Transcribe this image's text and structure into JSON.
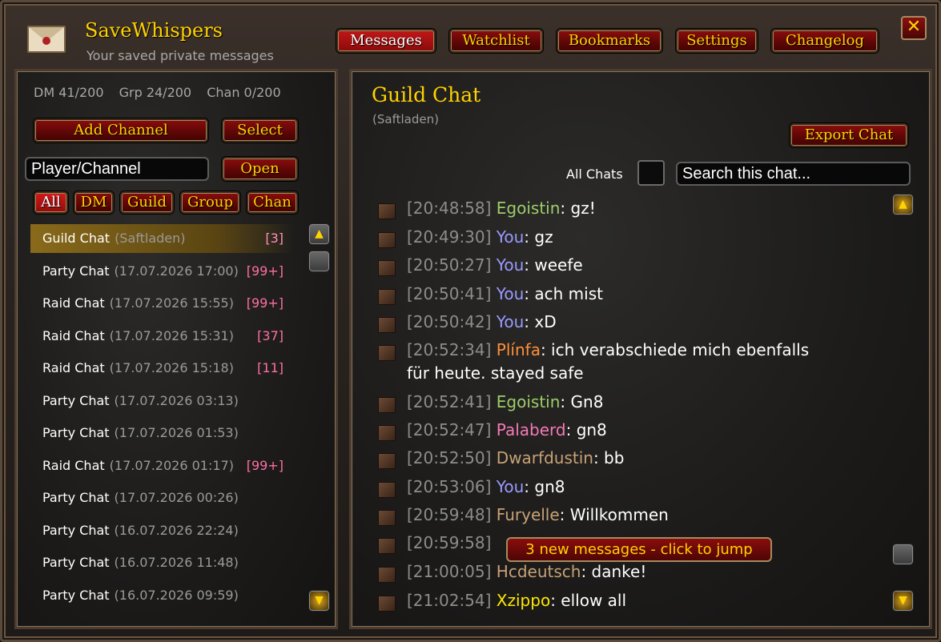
{
  "app": {
    "title": "SaveWhispers",
    "subtitle": "Your saved private messages"
  },
  "tabs": [
    {
      "label": "Messages",
      "active": true
    },
    {
      "label": "Watchlist",
      "active": false
    },
    {
      "label": "Bookmarks",
      "active": false
    },
    {
      "label": "Settings",
      "active": false
    },
    {
      "label": "Changelog",
      "active": false
    }
  ],
  "close_icon": "x-icon",
  "left": {
    "counts": [
      "DM 41/200",
      "Grp 24/200",
      "Chan 0/200"
    ],
    "add_channel": "Add Channel",
    "select": "Select",
    "player_input": {
      "value": "Player/Channel"
    },
    "open": "Open",
    "filters": [
      "All",
      "DM",
      "Guild",
      "Group",
      "Chan"
    ],
    "active_filter": "All",
    "chats": [
      {
        "name": "Guild Chat",
        "date": "(Saftladen)",
        "count": "[3]",
        "selected": true
      },
      {
        "name": "Party Chat",
        "date": "(17.07.2026 17:00)",
        "count": "[99+]"
      },
      {
        "name": "Raid Chat",
        "date": "(17.07.2026 15:55)",
        "count": "[99+]"
      },
      {
        "name": "Raid Chat",
        "date": "(17.07.2026 15:31)",
        "count": "[37]"
      },
      {
        "name": "Raid Chat",
        "date": "(17.07.2026 15:18)",
        "count": "[11]"
      },
      {
        "name": "Party Chat",
        "date": "(17.07.2026 03:13)",
        "count": ""
      },
      {
        "name": "Party Chat",
        "date": "(17.07.2026 01:53)",
        "count": ""
      },
      {
        "name": "Raid Chat",
        "date": "(17.07.2026 01:17)",
        "count": "[99+]"
      },
      {
        "name": "Party Chat",
        "date": "(17.07.2026 00:26)",
        "count": ""
      },
      {
        "name": "Party Chat",
        "date": "(16.07.2026 22:24)",
        "count": ""
      },
      {
        "name": "Party Chat",
        "date": "(16.07.2026 11:48)",
        "count": ""
      },
      {
        "name": "Party Chat",
        "date": "(16.07.2026 09:59)",
        "count": ""
      }
    ]
  },
  "chat": {
    "title": "Guild Chat",
    "subtitle": "(Saftladen)",
    "export": "Export Chat",
    "all_chats_label": "All Chats",
    "search_placeholder": "Search this chat...",
    "jump": "3 new messages - click to jump",
    "messages": [
      {
        "ts": "[20:48:58]",
        "sender": "Egoistin",
        "color": "green",
        "text": ": gz!"
      },
      {
        "ts": "[20:49:30]",
        "sender": "You",
        "color": "you",
        "text": ": gz"
      },
      {
        "ts": "[20:50:27]",
        "sender": "You",
        "color": "you",
        "text": ": weefe"
      },
      {
        "ts": "[20:50:41]",
        "sender": "You",
        "color": "you",
        "text": ": ach mist"
      },
      {
        "ts": "[20:50:42]",
        "sender": "You",
        "color": "you",
        "text": ": xD"
      },
      {
        "ts": "[20:52:34]",
        "sender": "Plínfa",
        "color": "orange",
        "text": ": ich verabschiede mich ebenfalls",
        "text2": "für heute. stayed safe"
      },
      {
        "ts": "[20:52:41]",
        "sender": "Egoistin",
        "color": "green",
        "text": ": Gn8"
      },
      {
        "ts": "[20:52:47]",
        "sender": "Palaberd",
        "color": "pink",
        "text": ": gn8"
      },
      {
        "ts": "[20:52:50]",
        "sender": "Dwarfdustin",
        "color": "tan",
        "text": ": bb"
      },
      {
        "ts": "[20:53:06]",
        "sender": "You",
        "color": "you",
        "text": ": gn8"
      },
      {
        "ts": "[20:59:48]",
        "sender": "Furyelle",
        "color": "tan",
        "text": ": Willkommen"
      },
      {
        "ts": "[20:59:58]",
        "sender": "",
        "color": "",
        "text": ""
      },
      {
        "ts": "[21:00:05]",
        "sender": "Hcdeutsch",
        "color": "tan",
        "text": ": danke!"
      },
      {
        "ts": "[21:02:54]",
        "sender": "Xzippo",
        "color": "yellow",
        "text": ": ellow all"
      }
    ]
  },
  "icons": {
    "message_icon": "book-icon",
    "scroll_up": "arrow-up-icon",
    "scroll_down": "arrow-down-icon",
    "scroll_thumb": "scroll-thumb-icon"
  }
}
